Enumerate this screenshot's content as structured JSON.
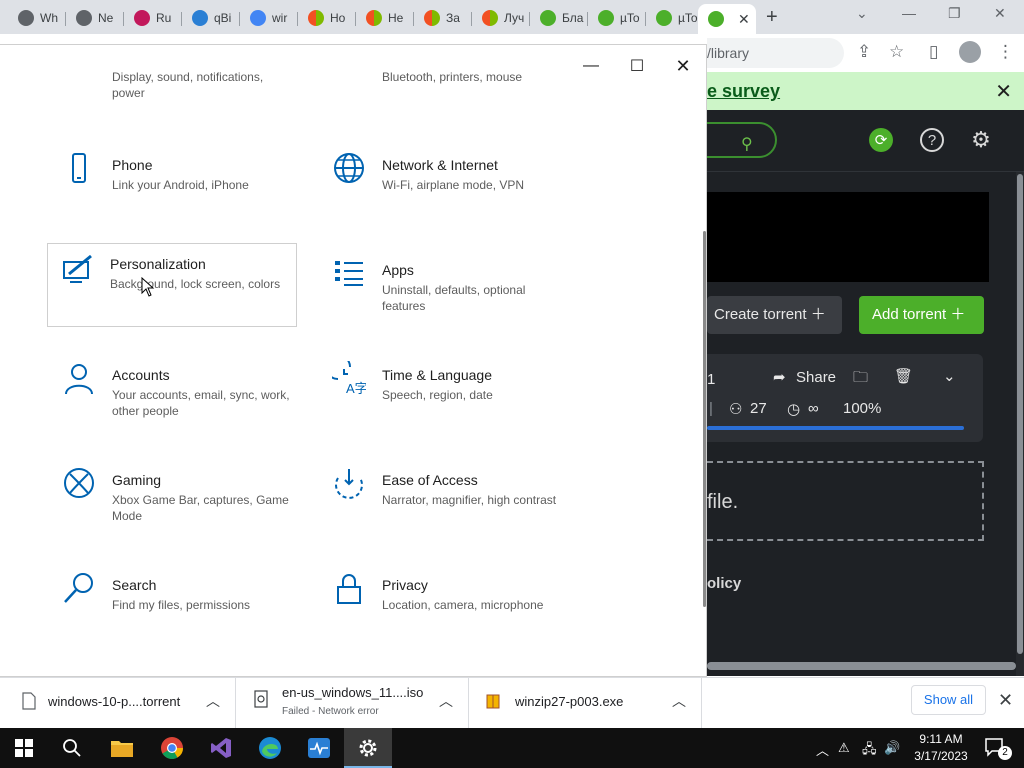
{
  "browser": {
    "tabs": [
      {
        "label": "Wh",
        "favicon_color": "#5f6368"
      },
      {
        "label": "Ne",
        "favicon_color": "#5f6368"
      },
      {
        "label": "Ru",
        "favicon_color": "#c2185b"
      },
      {
        "label": "qBi",
        "favicon_color": "#2a7fd4"
      },
      {
        "label": "wir",
        "favicon_color": "#4285f4"
      },
      {
        "label": "Ho",
        "favicon_color": "#f25022"
      },
      {
        "label": "He",
        "favicon_color": "#f25022"
      },
      {
        "label": "За",
        "favicon_color": "#f25022"
      },
      {
        "label": "Луч",
        "favicon_color": "#f25022"
      },
      {
        "label": "Бла",
        "favicon_color": "#4caf2a"
      },
      {
        "label": "µTo",
        "favicon_color": "#4caf2a"
      },
      {
        "label": "µTo",
        "favicon_color": "#4caf2a"
      },
      {
        "label": "",
        "favicon_color": "#4caf2a"
      }
    ],
    "new_tab": "+",
    "address_text": "/library"
  },
  "webpage": {
    "survey_text": "e survey",
    "create_torrent": "Create torrent",
    "add_torrent": "Add torrent",
    "torrent": {
      "name_fragment": "1",
      "share": "Share",
      "peers": "27",
      "eta": "∞",
      "progress_text": "100%",
      "progress": 100
    },
    "dropzone_text": "file.",
    "policy_text": "olicy"
  },
  "settings": {
    "categories": [
      {
        "title": "Phone",
        "desc": "Link your Android, iPhone",
        "icon": "phone-icon"
      },
      {
        "title": "Network & Internet",
        "desc": "Wi-Fi, airplane mode, VPN",
        "icon": "globe-icon"
      },
      {
        "title": "Personalization",
        "desc": "Background, lock screen, colors",
        "icon": "personalization-icon"
      },
      {
        "title": "Apps",
        "desc": "Uninstall, defaults, optional features",
        "icon": "apps-list-icon"
      },
      {
        "title": "Accounts",
        "desc": "Your accounts, email, sync, work, other people",
        "icon": "person-icon"
      },
      {
        "title": "Time & Language",
        "desc": "Speech, region, date",
        "icon": "time-language-icon"
      },
      {
        "title": "Gaming",
        "desc": "Xbox Game Bar, captures, Game Mode",
        "icon": "xbox-icon"
      },
      {
        "title": "Ease of Access",
        "desc": "Narrator, magnifier, high contrast",
        "icon": "ease-of-access-icon"
      },
      {
        "title": "Search",
        "desc": "Find my files, permissions",
        "icon": "search-icon"
      },
      {
        "title": "Privacy",
        "desc": "Location, camera, microphone",
        "icon": "lock-icon"
      }
    ],
    "cut_off": {
      "system_desc": "Display, sound, notifications, power",
      "devices_desc": "Bluetooth, printers, mouse"
    }
  },
  "downloads": {
    "items": [
      {
        "name": "windows-10-p....torrent",
        "status": ""
      },
      {
        "name": "en-us_windows_11....iso",
        "status": "Failed - Network error"
      },
      {
        "name": "winzip27-p003.exe",
        "status": ""
      }
    ],
    "show_all": "Show all"
  },
  "taskbar": {
    "time": "9:11 AM",
    "date": "3/17/2023",
    "notifications_count": "2"
  },
  "colors": {
    "accent": "#0063b1",
    "utorrent_green": "#4caf2a"
  }
}
